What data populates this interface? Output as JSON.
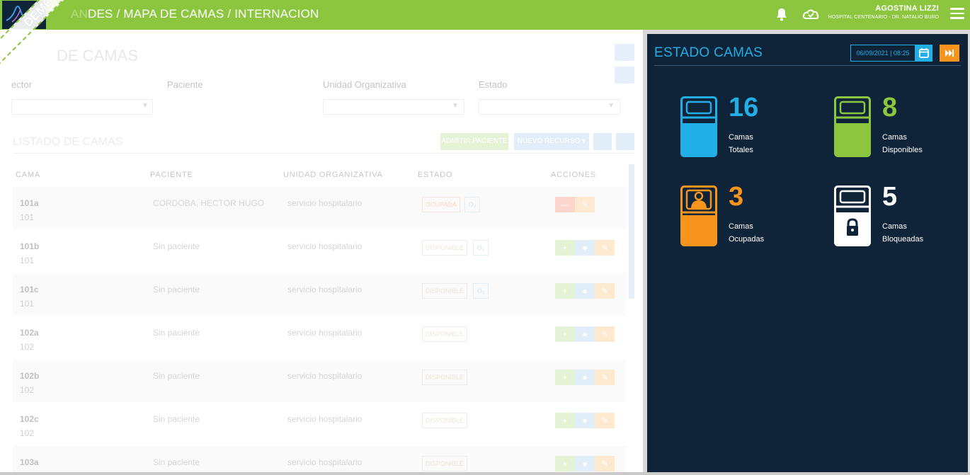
{
  "topbar": {
    "breadcrumb_faded": "AN",
    "breadcrumb": "DES / MAPA DE CAMAS / INTERNACION",
    "demo_badge": "DEMO",
    "user_name": "AGOSTINA LIZZI",
    "user_org": "HOSPITAL CENTENARIO - DR. NATALIO BURD",
    "icons": [
      "bell-icon",
      "cloud-icon",
      "menu-icon"
    ]
  },
  "left": {
    "ghost_title": "DE CAMAS",
    "filters": {
      "sector": "ector",
      "paciente": "Paciente",
      "unidad": "Unidad Organizativa",
      "estado": "Estado"
    },
    "list_title": "LISTADO DE CAMAS",
    "btn_admit": "ADMITIR PACIENTE",
    "btn_new": "NUEVO RECURSO ▾",
    "headers": {
      "cama": "CAMA",
      "paciente": "PACIENTE",
      "unidad": "UNIDAD ORGANIZATIVA",
      "estado": "ESTADO",
      "acciones": "ACCIONES"
    },
    "rows": [
      {
        "cama": "101a",
        "sub": "101",
        "paciente": "CORDOBA, HECTOR HUGO",
        "unidad": "servicio hospitalario",
        "estado": "OCUPADA",
        "o2": "O₂"
      },
      {
        "cama": "101b",
        "sub": "101",
        "paciente": "Sin paciente",
        "unidad": "servicio hospitalario",
        "estado": "DISPONIBLE",
        "o2": "O₂"
      },
      {
        "cama": "101c",
        "sub": "101",
        "paciente": "Sin paciente",
        "unidad": "servicio hospitalario",
        "estado": "DISPONIBLE",
        "o2": "O₂"
      },
      {
        "cama": "102a",
        "sub": "102",
        "paciente": "Sin paciente",
        "unidad": "servicio hospitalario",
        "estado": "DISPONIBLE"
      },
      {
        "cama": "102b",
        "sub": "102",
        "paciente": "Sin paciente",
        "unidad": "servicio hospitalario",
        "estado": "DISPONIBLE"
      },
      {
        "cama": "102c",
        "sub": "102",
        "paciente": "Sin paciente",
        "unidad": "servicio hospitalario",
        "estado": "DISPONIBLE"
      },
      {
        "cama": "103a",
        "paciente": "Sin paciente",
        "unidad": "servicio hospitalario",
        "estado": "DISPONIBLE"
      }
    ]
  },
  "panel": {
    "title": "ESTADO CAMAS",
    "date": "06/09/2021 | 08:25",
    "stats": {
      "totales": {
        "value": "16",
        "line1": "Camas",
        "line2": "Totales",
        "color": "#22aee6"
      },
      "disponibles": {
        "value": "8",
        "line1": "Camas",
        "line2": "Disponibles",
        "color": "#8cc63f"
      },
      "ocupadas": {
        "value": "3",
        "line1": "Camas",
        "line2": "Ocupadas",
        "color": "#f7941d"
      },
      "bloqueadas": {
        "value": "5",
        "line1": "Camas",
        "line2": "Bloqueadas",
        "color": "#ffffff"
      }
    }
  }
}
